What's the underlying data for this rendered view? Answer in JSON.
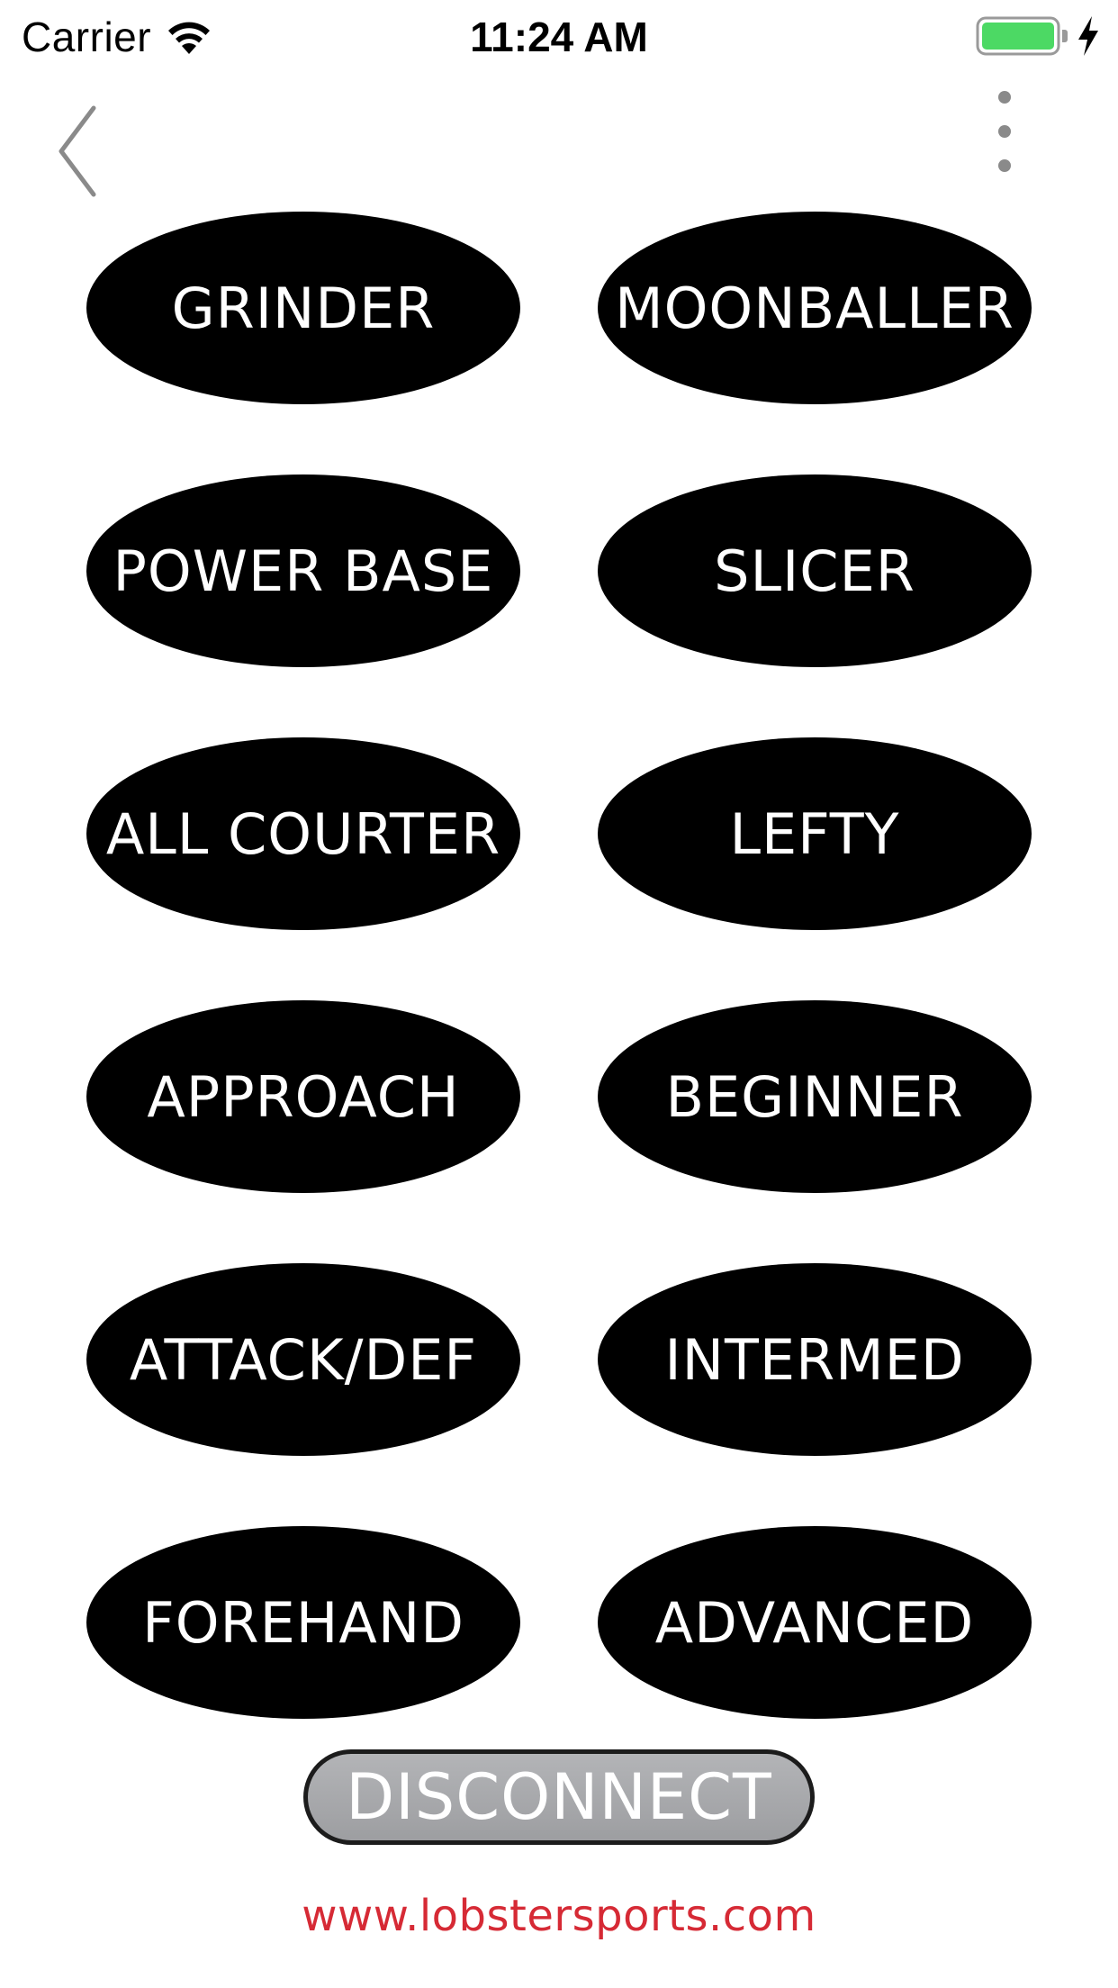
{
  "status_bar": {
    "carrier": "Carrier",
    "time": "11:24 AM",
    "battery_color": "#4cd964"
  },
  "nav": {
    "back_icon": "chevron-left-icon",
    "more_icon": "vertical-ellipsis-icon"
  },
  "modes": [
    "GRINDER",
    "MOONBALLER",
    "POWER BASE",
    "SLICER",
    "ALL COURTER",
    "LEFTY",
    "APPROACH",
    "BEGINNER",
    "ATTACK/DEF",
    "INTERMED",
    "FOREHAND",
    "ADVANCED"
  ],
  "disconnect_label": "DISCONNECT",
  "website": "www.lobstersports.com",
  "colors": {
    "oval": "#000000",
    "oval_text": "#ffffff",
    "disconnect_fill": "#a8a9ac",
    "website": "#d62a35"
  }
}
